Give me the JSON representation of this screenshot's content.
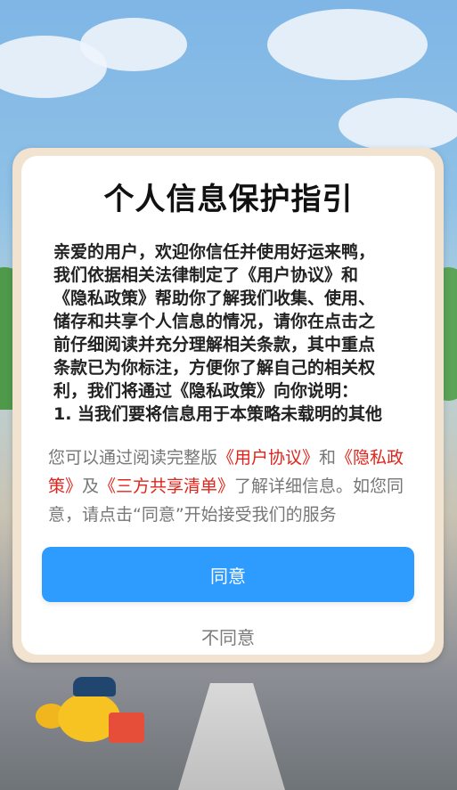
{
  "dialog": {
    "title": "个人信息保护指引",
    "agreement_lines": [
      "亲爱的用户，欢迎你信任并使用好运来鸭，",
      "我们依据相关法律制定了《用户协议》和",
      "《隐私政策》帮助你了解我们收集、使用、",
      "储存和共享个人信息的情况，请你在点击之",
      "前仔细阅读并充分理解相关条款，其中重点",
      "条款已为你标注，方便你了解自己的相关权",
      "利，我们将通过《隐私政策》向你说明：",
      "1. 当我们要将信息用于本策略未载明的其他"
    ],
    "info": {
      "prefix": "您可以通过阅读完整版",
      "link_user": "《用户协议》",
      "and": "和",
      "link_privacy": "《隐私政策》",
      "and2": "及",
      "link_share": "《三方共享清单》",
      "suffix": "了解详细信息。如您同意，请点击“同意”开始接受我们的服务"
    },
    "agree_label": "同意",
    "disagree_label": "不同意"
  },
  "colors": {
    "primary": "#2e9bff",
    "link": "#e0241b",
    "frame": "#f1e3cf"
  }
}
